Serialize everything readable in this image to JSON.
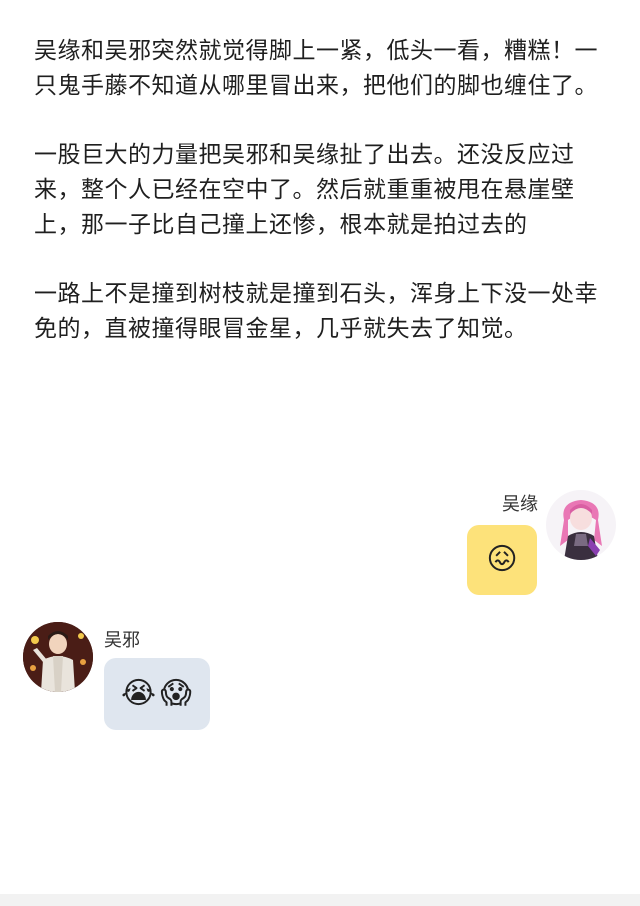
{
  "story": {
    "paragraphs": [
      "吴缘和吴邪突然就觉得脚上一紧，低头一看，糟糕！一只鬼手藤不知道从哪里冒出来，把他们的脚也缠住了。",
      "一股巨大的力量把吴邪和吴缘扯了出去。还没反应过来，整个人已经在空中了。然后就重重被甩在悬崖壁上，那一子比自己撞上还惨，根本就是拍过去的",
      "一路上不是撞到树枝就是撞到石头，浑身上下没一处幸免的，直被撞得眼冒金星，几乎就失去了知觉。"
    ]
  },
  "messages": [
    {
      "sender": "吴缘",
      "side": "right",
      "bubble_color": "#fde27a",
      "emojis": [
        "😖"
      ]
    },
    {
      "sender": "吴邪",
      "side": "left",
      "bubble_color": "#dfe6ef",
      "emojis": [
        "😭",
        "😱"
      ]
    }
  ]
}
